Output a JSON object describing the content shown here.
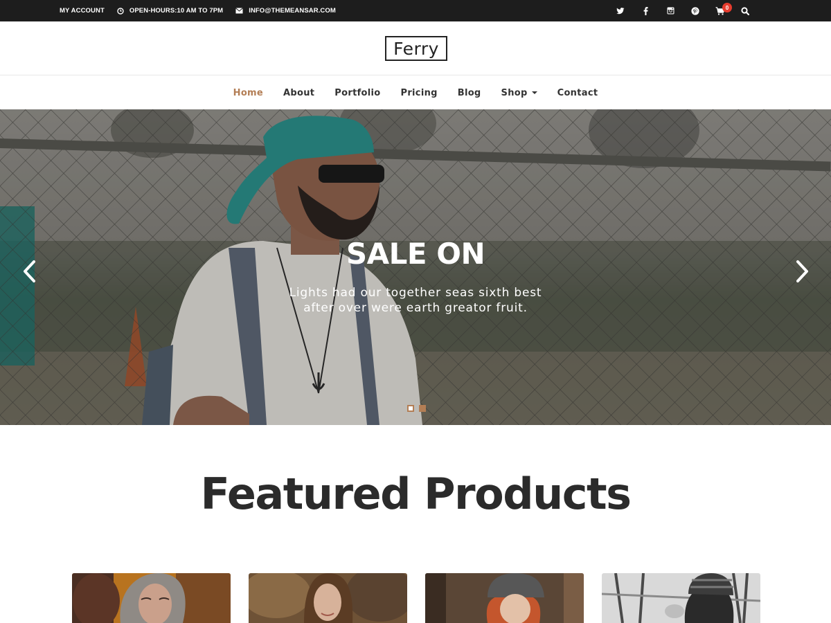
{
  "topbar": {
    "account": "MY ACCOUNT",
    "hours": "OPEN-HOURS:10 AM TO 7PM",
    "email": "INFO@THEMEANSAR.COM",
    "cart_count": "0",
    "icons": [
      "twitter-icon",
      "facebook-icon",
      "instagram-icon",
      "pinterest-icon",
      "cart-icon",
      "search-icon"
    ]
  },
  "logo": {
    "text": "Ferry"
  },
  "nav": {
    "items": [
      "Home",
      "About",
      "Portfolio",
      "Pricing",
      "Blog",
      "Shop",
      "Contact"
    ],
    "active": "Home"
  },
  "hero": {
    "title": "SALE ON",
    "subtitle": "Lights had our together seas sixth best after over were earth greator fruit.",
    "slide_count": 2,
    "active_slide": 1
  },
  "featured": {
    "title": "Featured Products"
  },
  "colors": {
    "accent": "#b37e55",
    "topbar": "#1d1d1d",
    "badge": "#e63c2e",
    "text": "#333333"
  }
}
